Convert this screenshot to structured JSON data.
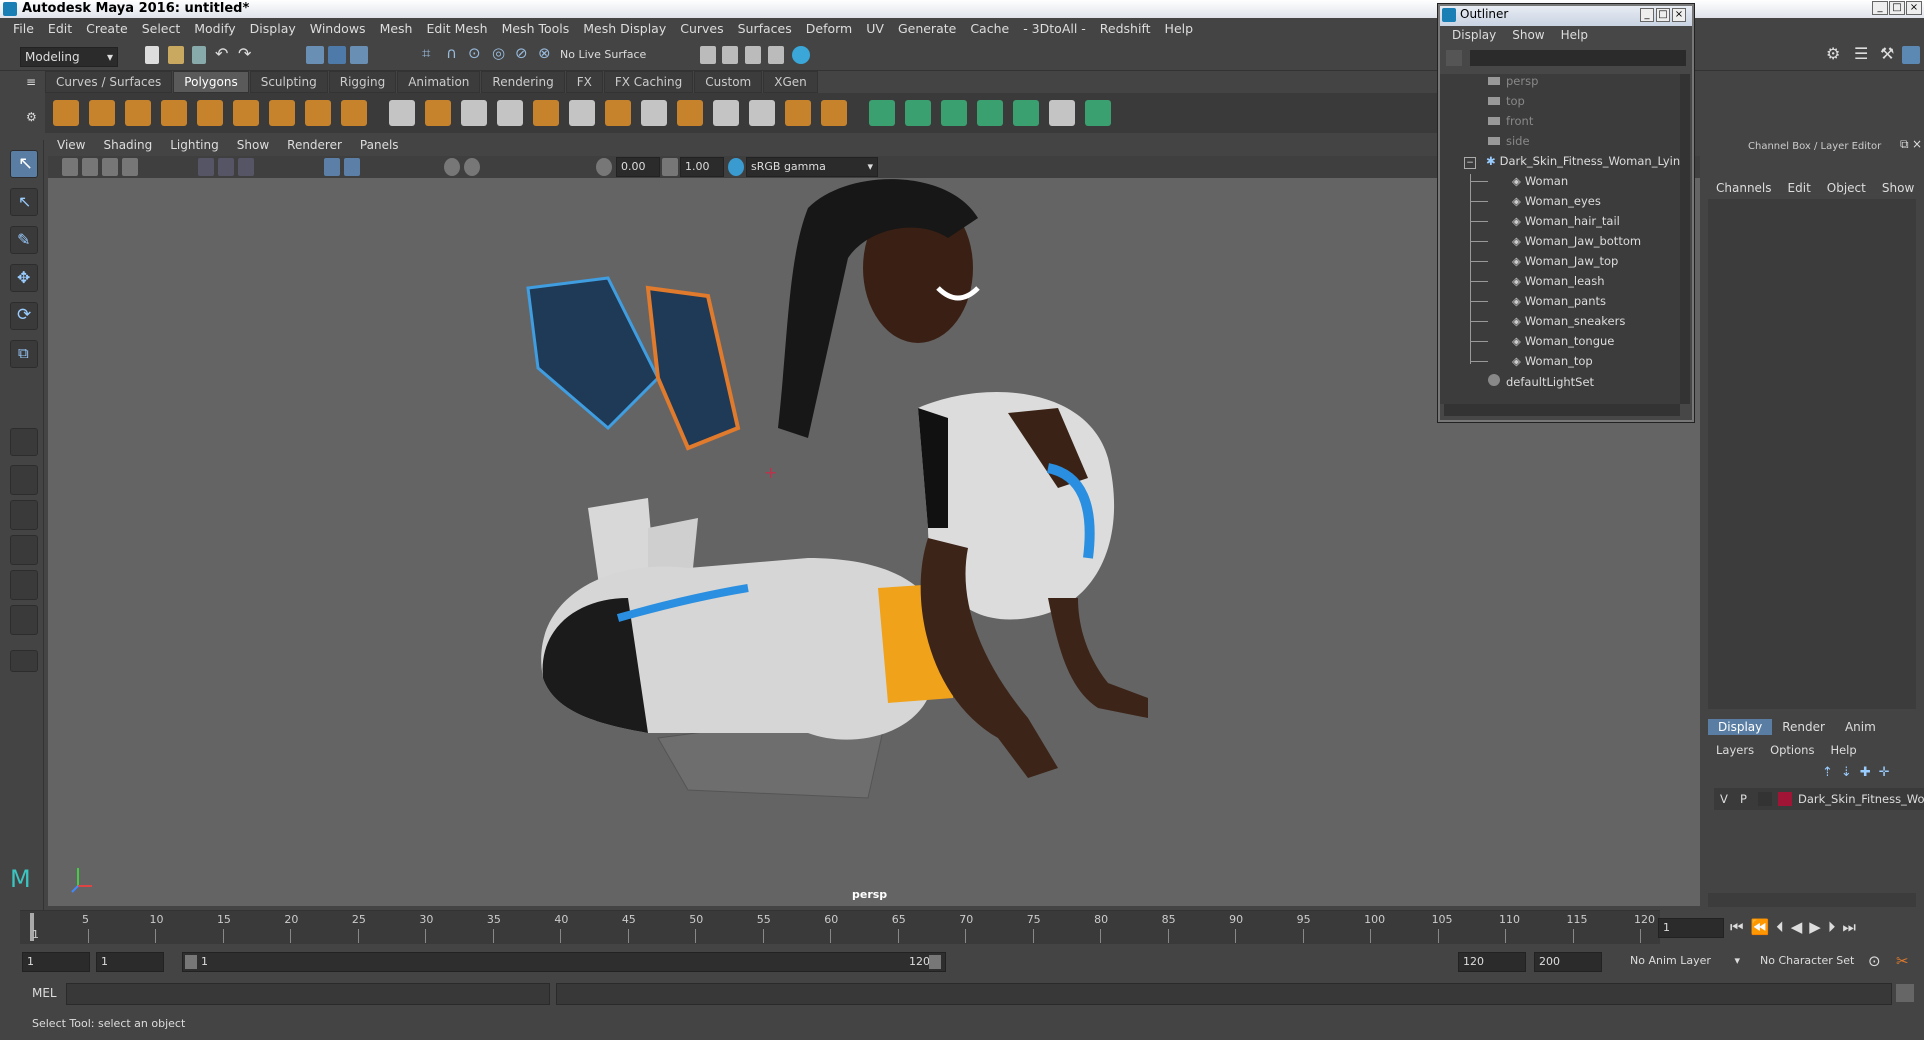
{
  "window": {
    "title": "Autodesk Maya 2016: untitled*"
  },
  "menubar": [
    "File",
    "Edit",
    "Create",
    "Select",
    "Modify",
    "Display",
    "Windows",
    "Mesh",
    "Edit Mesh",
    "Mesh Tools",
    "Mesh Display",
    "Curves",
    "Surfaces",
    "Deform",
    "UV",
    "Generate",
    "Cache",
    "- 3DtoAll -",
    "Redshift",
    "Help"
  ],
  "statusline": {
    "mode": "Modeling",
    "live_surface": "No Live Surface"
  },
  "shelf": {
    "tabs": [
      "Curves / Surfaces",
      "Polygons",
      "Sculpting",
      "Rigging",
      "Animation",
      "Rendering",
      "FX",
      "FX Caching",
      "Custom",
      "XGen"
    ],
    "active_tab": "Polygons"
  },
  "panel": {
    "menus": [
      "View",
      "Shading",
      "Lighting",
      "Show",
      "Renderer",
      "Panels"
    ],
    "exposure": "0.00",
    "gamma": "1.00",
    "colorspace": "sRGB gamma",
    "camera_label": "persp"
  },
  "timeline": {
    "ticks": [
      "5",
      "10",
      "15",
      "20",
      "25",
      "30",
      "35",
      "40",
      "45",
      "50",
      "55",
      "60",
      "65",
      "70",
      "75",
      "80",
      "85",
      "90",
      "95",
      "100",
      "105",
      "110",
      "115",
      "120"
    ],
    "current_marker": "1",
    "current_frame": "1"
  },
  "range": {
    "start": "1",
    "start2": "1",
    "slider_start": "1",
    "slider_end": "120",
    "end": "120",
    "end2": "200",
    "anim_layer": "No Anim Layer",
    "character_set": "No Character Set"
  },
  "cmdline": {
    "label": "MEL"
  },
  "helpline": {
    "text": "Select Tool: select an object"
  },
  "outliner": {
    "title": "Outliner",
    "menus": [
      "Display",
      "Show",
      "Help"
    ],
    "cameras": [
      "persp",
      "top",
      "front",
      "side"
    ],
    "group": "Dark_Skin_Fitness_Woman_Lying",
    "children": [
      "Woman",
      "Woman_eyes",
      "Woman_hair_tail",
      "Woman_Jaw_bottom",
      "Woman_Jaw_top",
      "Woman_leash",
      "Woman_pants",
      "Woman_sneakers",
      "Woman_tongue",
      "Woman_top"
    ],
    "set": "defaultLightSet"
  },
  "channelbox": {
    "title": "Channel Box / Layer Editor",
    "menus": [
      "Channels",
      "Edit",
      "Object",
      "Show"
    ],
    "layer_tabs": [
      "Display",
      "Render",
      "Anim"
    ],
    "layer_menus": [
      "Layers",
      "Options",
      "Help"
    ],
    "layer": {
      "v": "V",
      "p": "P",
      "name": "Dark_Skin_Fitness_Wo"
    }
  }
}
